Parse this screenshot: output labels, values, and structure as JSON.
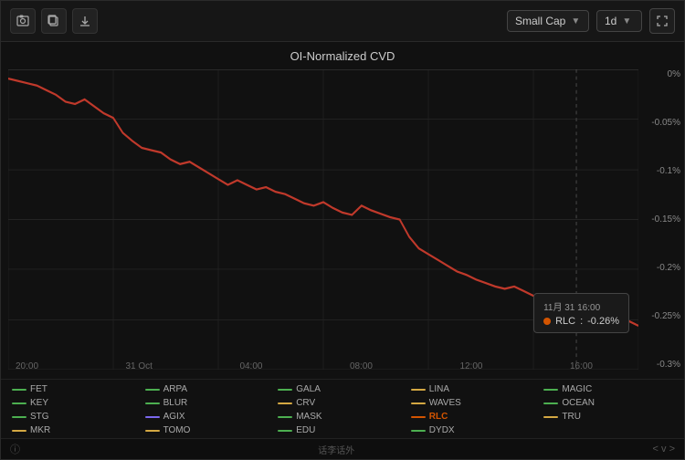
{
  "toolbar": {
    "icons": [
      "screenshot-icon",
      "camera-icon",
      "download-icon"
    ],
    "dropdown_market": "Small Cap",
    "dropdown_period": "1d",
    "expand_icon": "expand-icon"
  },
  "chart": {
    "title": "OI-Normalized CVD",
    "y_labels": [
      "0%",
      "-0.05%",
      "-0.1%",
      "-0.15%",
      "-0.2%",
      "-0.25%",
      "-0.3%"
    ],
    "x_labels": [
      "20:00",
      "31 Oct",
      "04:00",
      "08:00",
      "12:00",
      "16:00"
    ]
  },
  "tooltip": {
    "title": "11月 31 16:00",
    "label": "RLC",
    "value": "-0.26%"
  },
  "legend": [
    {
      "name": "FET",
      "color": "#4CAF50"
    },
    {
      "name": "ARPA",
      "color": "#4CAF50"
    },
    {
      "name": "GALA",
      "color": "#4CAF50"
    },
    {
      "name": "LINA",
      "color": "#d4a843"
    },
    {
      "name": "MAGIC",
      "color": "#4CAF50"
    },
    {
      "name": "KEY",
      "color": "#4CAF50"
    },
    {
      "name": "BLUR",
      "color": "#4CAF50"
    },
    {
      "name": "CRV",
      "color": "#d4a843"
    },
    {
      "name": "WAVES",
      "color": "#d4a843"
    },
    {
      "name": "OCEAN",
      "color": "#4CAF50"
    },
    {
      "name": "STG",
      "color": "#4CAF50"
    },
    {
      "name": "AGIX",
      "color": "#7b68ee"
    },
    {
      "name": "MASK",
      "color": "#4CAF50"
    },
    {
      "name": "RLC",
      "color": "#d35400"
    },
    {
      "name": "TRU",
      "color": "#d4a843"
    },
    {
      "name": "MKR",
      "color": "#d4a843"
    },
    {
      "name": "TOMO",
      "color": "#d4a843"
    },
    {
      "name": "EDU",
      "color": "#4CAF50"
    },
    {
      "name": "DYDX",
      "color": "#4CAF50"
    }
  ],
  "bottom": {
    "watermark": "话李话外",
    "nav": "< v >"
  }
}
